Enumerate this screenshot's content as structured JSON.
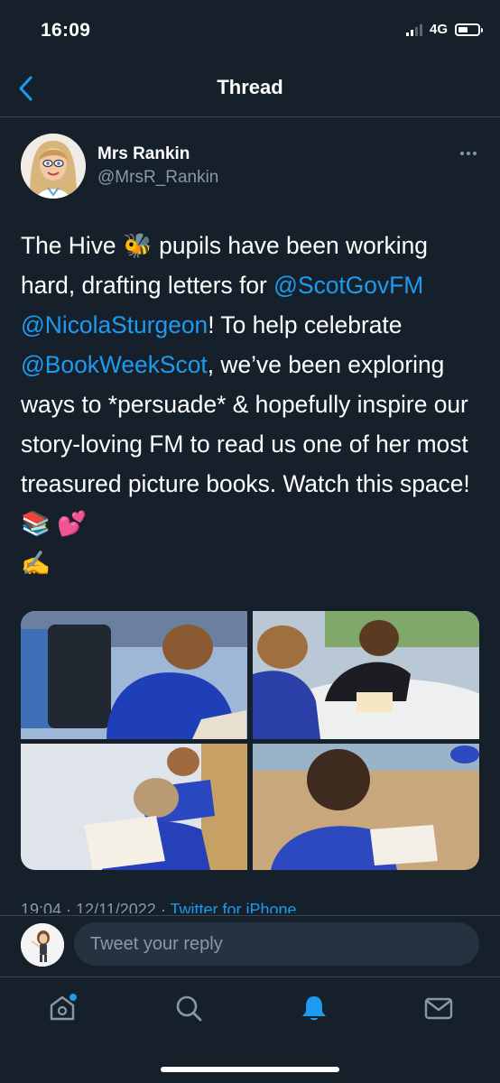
{
  "status_bar": {
    "time": "16:09",
    "network": "4G",
    "battery_level": 0.5
  },
  "nav": {
    "title": "Thread",
    "back_icon": "chevron-left-icon"
  },
  "tweet": {
    "author_name": "Mrs Rankin",
    "author_handle": "@MrsR_Rankin",
    "text": {
      "p1": "The Hive ",
      "emoji1": "🐝",
      "p2": " pupils have been working hard, drafting letters for ",
      "m1": "@ScotGovFM",
      "p3": " ",
      "m2": "@NicolaSturgeon",
      "p4": "! To help celebrate ",
      "m3": "@BookWeekScot",
      "p5": ", we’ve been exploring ways to *persuade* & hopefully inspire our story-loving FM to read us one of her most treasured picture books. Watch this space! ",
      "emoji2": "📚 💕",
      "emoji3": "✍️"
    },
    "meta": {
      "time": "19:04",
      "date": "12/11/2022",
      "via": "Twitter for iPhone"
    }
  },
  "reply": {
    "placeholder": "Tweet your reply"
  },
  "tabbar": {
    "items": [
      "home-icon",
      "search-icon",
      "notifications-icon",
      "messages-icon"
    ],
    "active": "notifications-icon"
  },
  "colors": {
    "background": "#15202b",
    "accent": "#1d9bf0",
    "secondary_text": "#8899a6",
    "divider": "#38444d"
  }
}
